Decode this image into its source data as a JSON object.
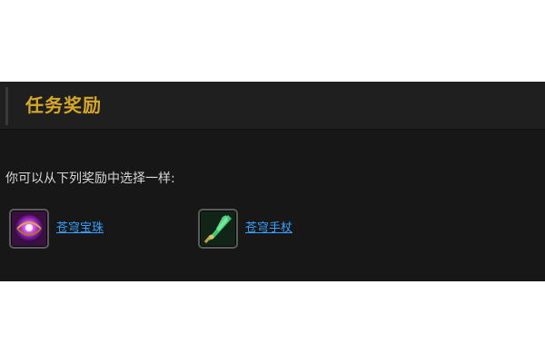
{
  "panel": {
    "title": "任务奖励",
    "prompt": "你可以从下列奖励中选择一样:"
  },
  "rewards": [
    {
      "name": "苍穹宝珠",
      "icon": "purple-orb-icon",
      "color": "#b23ad6"
    },
    {
      "name": "苍穹手杖",
      "icon": "green-crystal-staff-icon",
      "color": "#38c46a"
    }
  ],
  "colors": {
    "title": "#d7a728",
    "link": "#3aa0ff",
    "background": "#171717"
  }
}
